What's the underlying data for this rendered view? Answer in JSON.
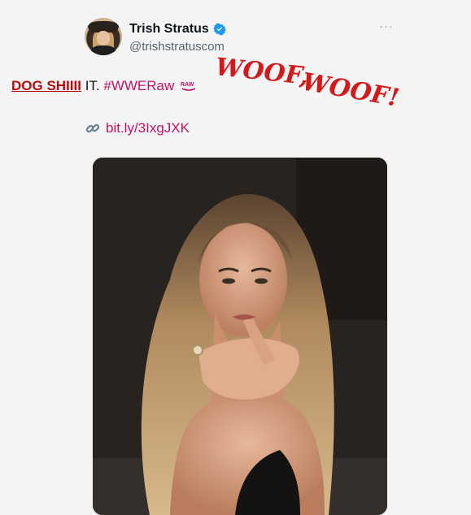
{
  "user": {
    "name": "Trish Stratus",
    "handle": "@trishstratuscom",
    "more": "···"
  },
  "overlay": {
    "woof_line1": "WOOF,",
    "woof_line2": "WOOF!"
  },
  "tweet": {
    "part1": "DOG SHIIII",
    "part2": " IT. ",
    "hashtag": "#WWERaw",
    "raw_logo_text": "RAW",
    "link_icon": "link-icon",
    "link": "bit.ly/3IxgJXK"
  },
  "colors": {
    "hashtag": "#c0126b",
    "dog_text": "#b10f0f",
    "woof": "#d2191b",
    "verified": "#1d9bf0"
  }
}
